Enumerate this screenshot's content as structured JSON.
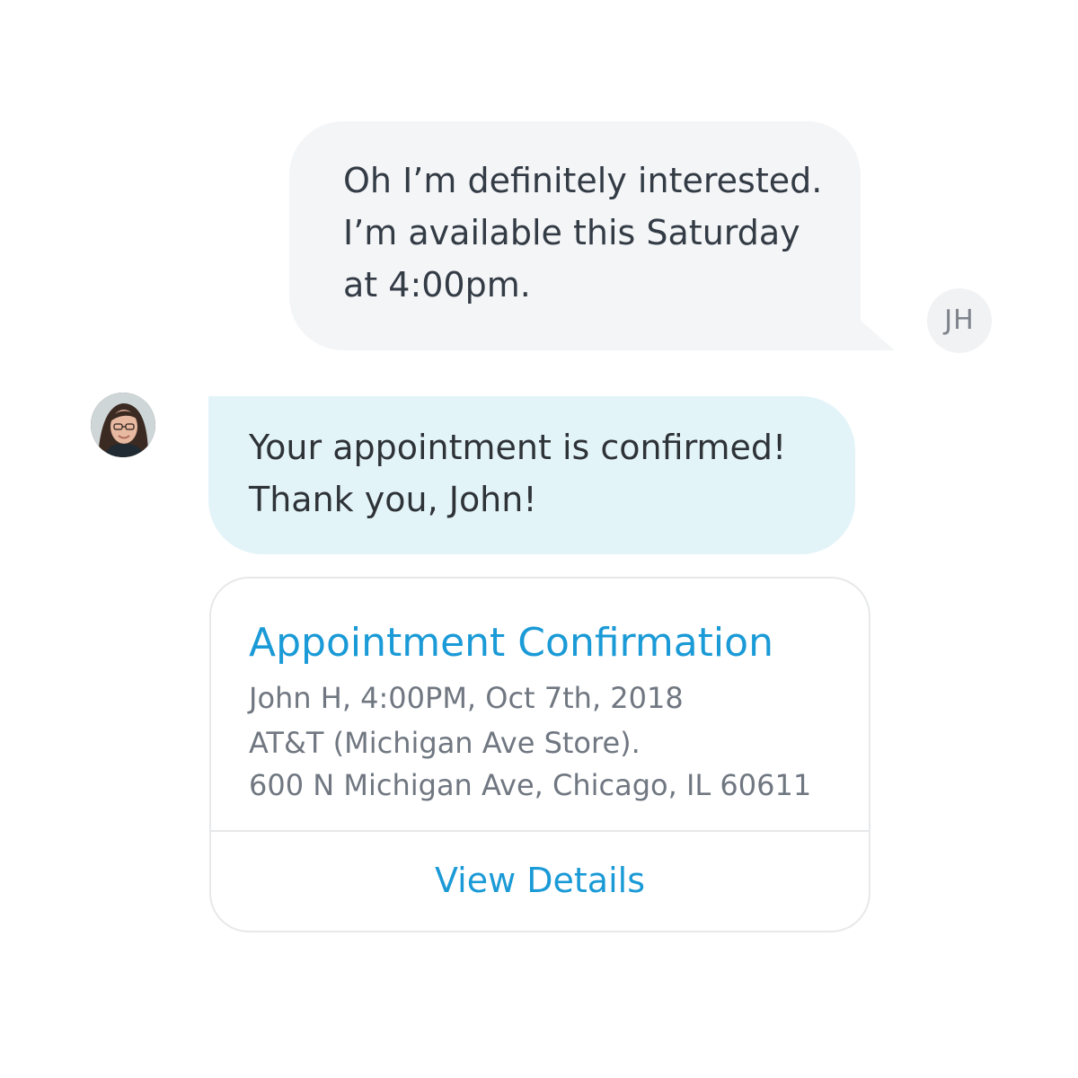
{
  "conversation": {
    "outgoing_message": {
      "text": "Oh I’m definitely interested.\nI’m available this Saturday\nat 4:00pm.",
      "sender_initials": "JH"
    },
    "incoming_message": {
      "text": "Your appointment is confirmed!\nThank you, John!",
      "sender_avatar": "agent-photo-avatar"
    },
    "rich_card": {
      "title": "Appointment Confirmation",
      "lines": [
        "John H, 4:00PM, Oct 7th, 2018",
        "AT&T (Michigan Ave Store).",
        "600 N Michigan Ave, Chicago, IL 60611"
      ],
      "action_label": "View Details"
    }
  },
  "colors": {
    "outgoing_bubble": "#f4f5f7",
    "incoming_bubble": "#e3f4f9",
    "accent": "#1a9ad6",
    "card_border": "#e7e8ea"
  }
}
